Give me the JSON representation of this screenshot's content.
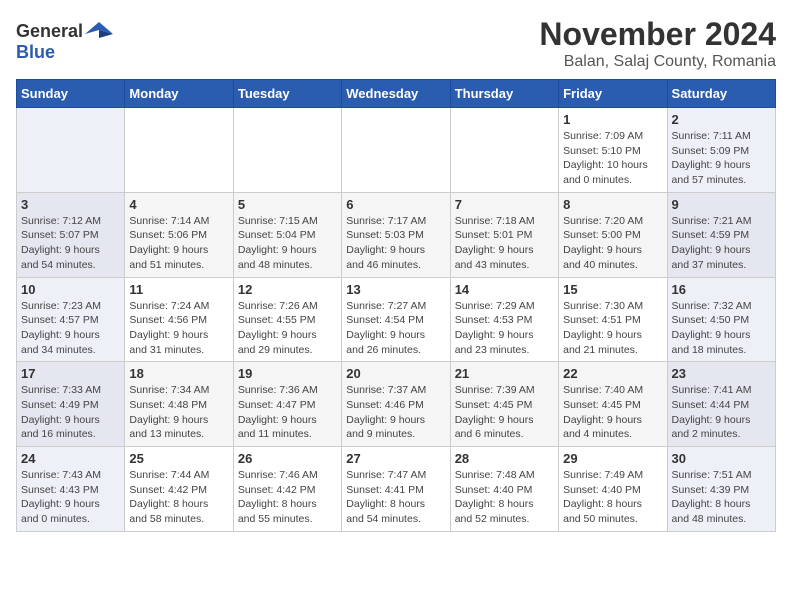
{
  "logo": {
    "general": "General",
    "blue": "Blue"
  },
  "title": "November 2024",
  "subtitle": "Balan, Salaj County, Romania",
  "weekdays": [
    "Sunday",
    "Monday",
    "Tuesday",
    "Wednesday",
    "Thursday",
    "Friday",
    "Saturday"
  ],
  "weeks": [
    [
      {
        "day": "",
        "info": ""
      },
      {
        "day": "",
        "info": ""
      },
      {
        "day": "",
        "info": ""
      },
      {
        "day": "",
        "info": ""
      },
      {
        "day": "",
        "info": ""
      },
      {
        "day": "1",
        "info": "Sunrise: 7:09 AM\nSunset: 5:10 PM\nDaylight: 10 hours\nand 0 minutes."
      },
      {
        "day": "2",
        "info": "Sunrise: 7:11 AM\nSunset: 5:09 PM\nDaylight: 9 hours\nand 57 minutes."
      }
    ],
    [
      {
        "day": "3",
        "info": "Sunrise: 7:12 AM\nSunset: 5:07 PM\nDaylight: 9 hours\nand 54 minutes."
      },
      {
        "day": "4",
        "info": "Sunrise: 7:14 AM\nSunset: 5:06 PM\nDaylight: 9 hours\nand 51 minutes."
      },
      {
        "day": "5",
        "info": "Sunrise: 7:15 AM\nSunset: 5:04 PM\nDaylight: 9 hours\nand 48 minutes."
      },
      {
        "day": "6",
        "info": "Sunrise: 7:17 AM\nSunset: 5:03 PM\nDaylight: 9 hours\nand 46 minutes."
      },
      {
        "day": "7",
        "info": "Sunrise: 7:18 AM\nSunset: 5:01 PM\nDaylight: 9 hours\nand 43 minutes."
      },
      {
        "day": "8",
        "info": "Sunrise: 7:20 AM\nSunset: 5:00 PM\nDaylight: 9 hours\nand 40 minutes."
      },
      {
        "day": "9",
        "info": "Sunrise: 7:21 AM\nSunset: 4:59 PM\nDaylight: 9 hours\nand 37 minutes."
      }
    ],
    [
      {
        "day": "10",
        "info": "Sunrise: 7:23 AM\nSunset: 4:57 PM\nDaylight: 9 hours\nand 34 minutes."
      },
      {
        "day": "11",
        "info": "Sunrise: 7:24 AM\nSunset: 4:56 PM\nDaylight: 9 hours\nand 31 minutes."
      },
      {
        "day": "12",
        "info": "Sunrise: 7:26 AM\nSunset: 4:55 PM\nDaylight: 9 hours\nand 29 minutes."
      },
      {
        "day": "13",
        "info": "Sunrise: 7:27 AM\nSunset: 4:54 PM\nDaylight: 9 hours\nand 26 minutes."
      },
      {
        "day": "14",
        "info": "Sunrise: 7:29 AM\nSunset: 4:53 PM\nDaylight: 9 hours\nand 23 minutes."
      },
      {
        "day": "15",
        "info": "Sunrise: 7:30 AM\nSunset: 4:51 PM\nDaylight: 9 hours\nand 21 minutes."
      },
      {
        "day": "16",
        "info": "Sunrise: 7:32 AM\nSunset: 4:50 PM\nDaylight: 9 hours\nand 18 minutes."
      }
    ],
    [
      {
        "day": "17",
        "info": "Sunrise: 7:33 AM\nSunset: 4:49 PM\nDaylight: 9 hours\nand 16 minutes."
      },
      {
        "day": "18",
        "info": "Sunrise: 7:34 AM\nSunset: 4:48 PM\nDaylight: 9 hours\nand 13 minutes."
      },
      {
        "day": "19",
        "info": "Sunrise: 7:36 AM\nSunset: 4:47 PM\nDaylight: 9 hours\nand 11 minutes."
      },
      {
        "day": "20",
        "info": "Sunrise: 7:37 AM\nSunset: 4:46 PM\nDaylight: 9 hours\nand 9 minutes."
      },
      {
        "day": "21",
        "info": "Sunrise: 7:39 AM\nSunset: 4:45 PM\nDaylight: 9 hours\nand 6 minutes."
      },
      {
        "day": "22",
        "info": "Sunrise: 7:40 AM\nSunset: 4:45 PM\nDaylight: 9 hours\nand 4 minutes."
      },
      {
        "day": "23",
        "info": "Sunrise: 7:41 AM\nSunset: 4:44 PM\nDaylight: 9 hours\nand 2 minutes."
      }
    ],
    [
      {
        "day": "24",
        "info": "Sunrise: 7:43 AM\nSunset: 4:43 PM\nDaylight: 9 hours\nand 0 minutes."
      },
      {
        "day": "25",
        "info": "Sunrise: 7:44 AM\nSunset: 4:42 PM\nDaylight: 8 hours\nand 58 minutes."
      },
      {
        "day": "26",
        "info": "Sunrise: 7:46 AM\nSunset: 4:42 PM\nDaylight: 8 hours\nand 55 minutes."
      },
      {
        "day": "27",
        "info": "Sunrise: 7:47 AM\nSunset: 4:41 PM\nDaylight: 8 hours\nand 54 minutes."
      },
      {
        "day": "28",
        "info": "Sunrise: 7:48 AM\nSunset: 4:40 PM\nDaylight: 8 hours\nand 52 minutes."
      },
      {
        "day": "29",
        "info": "Sunrise: 7:49 AM\nSunset: 4:40 PM\nDaylight: 8 hours\nand 50 minutes."
      },
      {
        "day": "30",
        "info": "Sunrise: 7:51 AM\nSunset: 4:39 PM\nDaylight: 8 hours\nand 48 minutes."
      }
    ]
  ]
}
